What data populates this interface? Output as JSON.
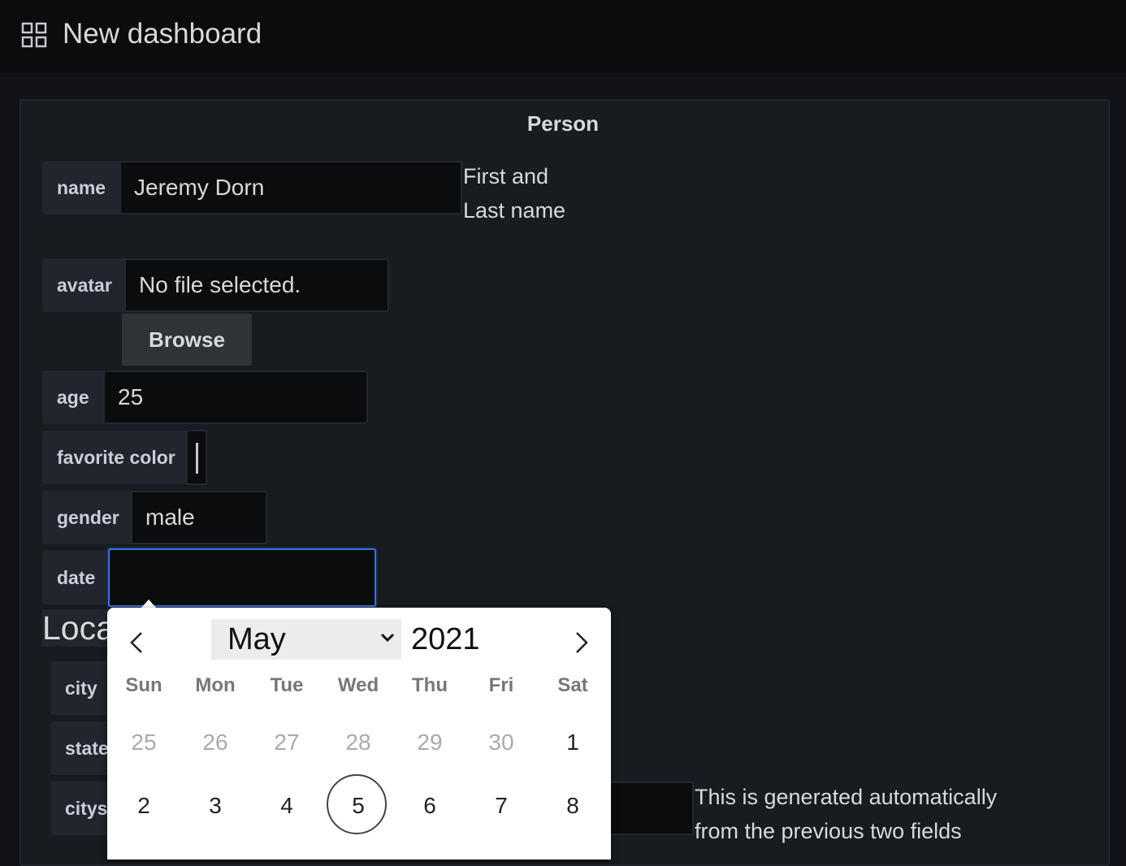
{
  "header": {
    "title": "New dashboard",
    "icon": "grid-icon"
  },
  "panel": {
    "title": "Person"
  },
  "form": {
    "name": {
      "label": "name",
      "value": "Jeremy Dorn",
      "help_line1": "First and",
      "help_line2": "Last name"
    },
    "avatar": {
      "label": "avatar",
      "value": "No file selected.",
      "browse_label": "Browse"
    },
    "age": {
      "label": "age",
      "value": "25"
    },
    "favorite_color": {
      "label": "favorite color"
    },
    "gender": {
      "label": "gender",
      "value": "male"
    },
    "date": {
      "label": "date",
      "value": ""
    },
    "location": {
      "title": "Loca",
      "city": {
        "label": "city"
      },
      "state": {
        "label": "state"
      },
      "citystate": {
        "label": "citys",
        "help_line1": "This is generated automatically",
        "help_line2": "from the previous two fields"
      }
    }
  },
  "datepicker": {
    "month": "May",
    "year": "2021",
    "weekdays": [
      "Sun",
      "Mon",
      "Tue",
      "Wed",
      "Thu",
      "Fri",
      "Sat"
    ],
    "week1": [
      "25",
      "26",
      "27",
      "28",
      "29",
      "30",
      "1"
    ],
    "week2": [
      "2",
      "3",
      "4",
      "5",
      "6",
      "7",
      "8"
    ],
    "selected_day": "5",
    "prev_icon": "chevron-left-icon",
    "next_icon": "chevron-right-icon"
  }
}
